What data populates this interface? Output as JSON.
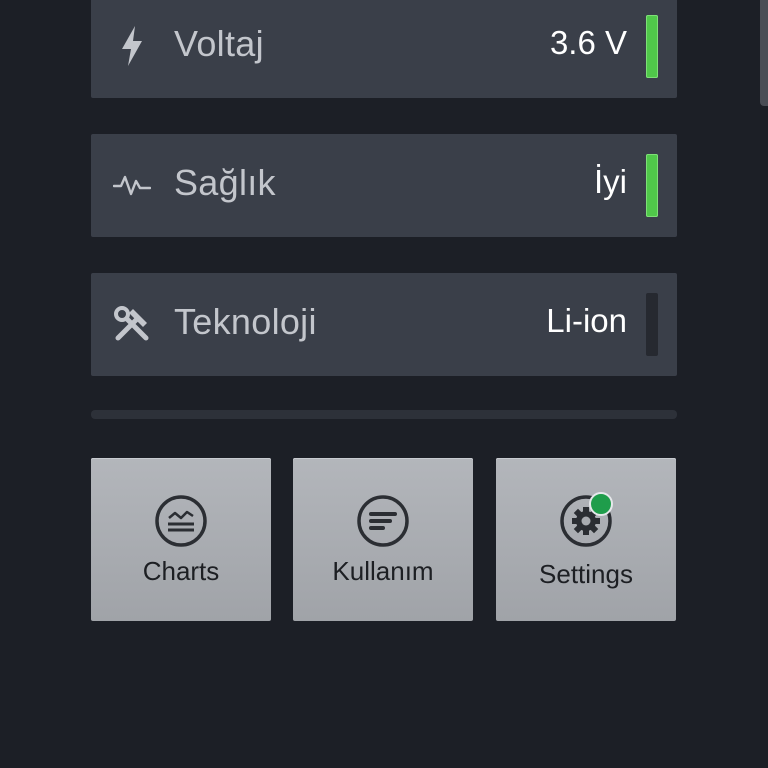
{
  "rows": [
    {
      "label": "Voltaj",
      "value": "3.6 V",
      "icon": "lightning-icon",
      "indicator": "green"
    },
    {
      "label": "Sağlık",
      "value": "İyi",
      "icon": "pulse-icon",
      "indicator": "green"
    },
    {
      "label": "Teknoloji",
      "value": "Li-ion",
      "icon": "tools-icon",
      "indicator": "none"
    }
  ],
  "buttons": {
    "charts": "Charts",
    "usage": "Kullanım",
    "settings": "Settings"
  },
  "colors": {
    "background": "#1c1f26",
    "row": "#3a3f49",
    "accent_green": "#50c84a",
    "notification_dot": "#1f9d4b"
  }
}
